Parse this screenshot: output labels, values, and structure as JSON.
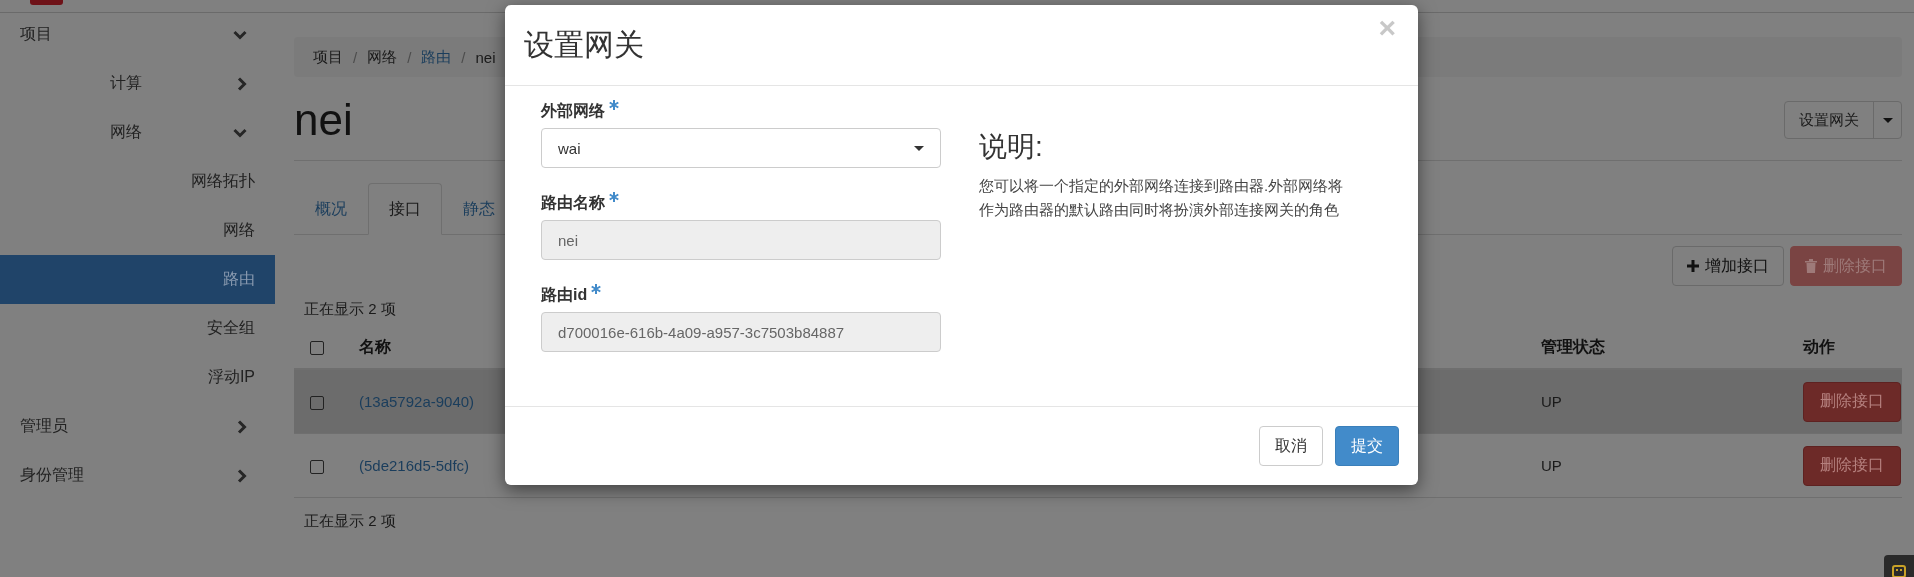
{
  "sidebar": {
    "items": [
      {
        "label": "项目",
        "expanded": true,
        "children": [
          {
            "label": "计算",
            "expanded": false
          },
          {
            "label": "网络",
            "expanded": true,
            "children": [
              {
                "label": "网络拓扑",
                "selected": false
              },
              {
                "label": "网络",
                "selected": false
              },
              {
                "label": "路由",
                "selected": true
              },
              {
                "label": "安全组",
                "selected": false
              },
              {
                "label": "浮动IP",
                "selected": false
              }
            ]
          }
        ]
      },
      {
        "label": "管理员",
        "expanded": false
      },
      {
        "label": "身份管理",
        "expanded": false
      }
    ]
  },
  "breadcrumb": [
    {
      "label": "项目",
      "link": false,
      "separator": "/"
    },
    {
      "label": "网络",
      "link": false,
      "separator": "/"
    },
    {
      "label": "路由",
      "link": true,
      "separator": "/"
    },
    {
      "label": "nei",
      "link": false
    }
  ],
  "page_title": "nei",
  "header_action": {
    "label": "设置网关"
  },
  "tabs": [
    {
      "label": "概况",
      "selected": false
    },
    {
      "label": "接口",
      "selected": true
    },
    {
      "label": "静态",
      "selected": false
    }
  ],
  "table_actions": [
    {
      "label": "增加接口",
      "kind": "add",
      "disabled": false
    },
    {
      "label": "删除接口",
      "kind": "delete",
      "disabled": true
    }
  ],
  "count_top": "正在显示 2 项",
  "table": {
    "select_all_checked": false,
    "columns": [
      {
        "label": "名称"
      },
      {
        "label": "管理状态"
      },
      {
        "label": "动作"
      }
    ],
    "rows": [
      {
        "checked": false,
        "hovered": true,
        "name": "(13a5792a-9040)",
        "admin_state": "UP",
        "action": "删除接口"
      },
      {
        "checked": false,
        "hovered": false,
        "name": "(5de216d5-5dfc)",
        "admin_state": "UP",
        "action": "删除接口"
      }
    ]
  },
  "count_bottom": "正在显示 2 项",
  "modal": {
    "title": "设置网关",
    "close": "×",
    "fields": [
      {
        "label": "外部网络",
        "required": true,
        "kind": "select",
        "value": "wai",
        "disabled": false
      },
      {
        "label": "路由名称",
        "required": true,
        "kind": "text",
        "value": "nei",
        "disabled": true
      },
      {
        "label": "路由id",
        "required": true,
        "kind": "text",
        "value": "d700016e-616b-4a09-a957-3c7503b84887",
        "disabled": true
      }
    ],
    "help_title": "说明:",
    "help_text": "您可以将一个指定的外部网络连接到路由器.外部网络将作为路由器的默认路由同时将扮演外部连接网关的角色",
    "buttons": [
      {
        "label": "取消",
        "kind": "default"
      },
      {
        "label": "提交",
        "kind": "primary"
      }
    ]
  }
}
